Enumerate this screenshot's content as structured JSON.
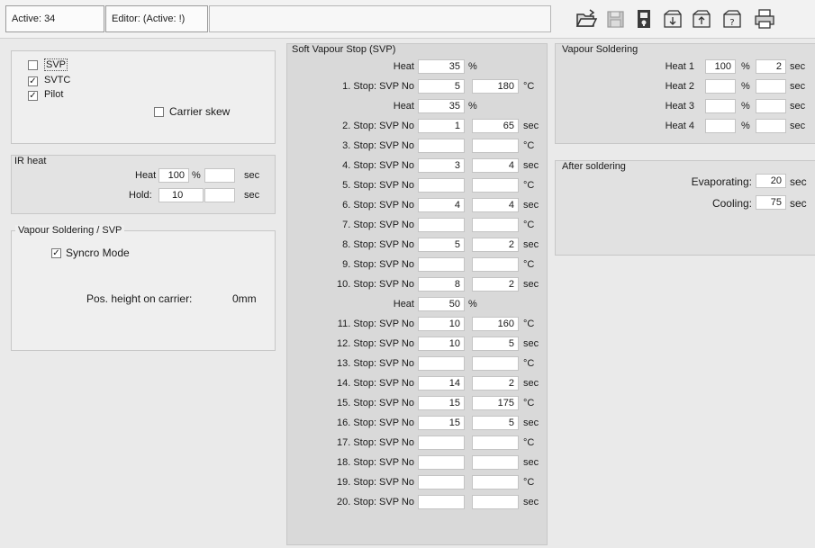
{
  "topbar": {
    "active": "Active: 34",
    "editor": "Editor:  (Active: !)",
    "icons": [
      "open-folder-icon",
      "save-disk-icon",
      "lock-icon",
      "tray-in-icon",
      "tray-out-icon",
      "tray-help-icon",
      "printer-icon"
    ]
  },
  "options": {
    "svp": {
      "label": "SVP",
      "checked": false
    },
    "svtc": {
      "label": "SVTC",
      "checked": true
    },
    "pilot": {
      "label": "Pilot",
      "checked": true
    },
    "carrier_skew": {
      "label": "Carrier skew",
      "checked": false
    }
  },
  "ir_heat": {
    "title": "IR heat",
    "heat_label": "Heat",
    "heat_value": "100",
    "heat_unit": "%",
    "heat_sec_unit": "sec",
    "hold_label": "Hold:",
    "hold_value": "10",
    "hold_unit": "sec"
  },
  "vs_svp": {
    "title": "Vapour Soldering / SVP",
    "syncro_label": "Syncro Mode",
    "syncro_checked": true,
    "pos_label": "Pos. height on carrier:",
    "pos_value": "0mm"
  },
  "svp": {
    "title": "Soft Vapour Stop (SVP)",
    "heat_label": "Heat",
    "pct": "%",
    "rows": [
      {
        "kind": "heat",
        "value": "35"
      },
      {
        "kind": "stop",
        "name": "1. Stop: SVP No",
        "no": "5",
        "val": "180",
        "unit": "°C"
      },
      {
        "kind": "heat",
        "value": "35"
      },
      {
        "kind": "stop",
        "name": "2. Stop: SVP No",
        "no": "1",
        "val": "65",
        "unit": "sec"
      },
      {
        "kind": "stop",
        "name": "3. Stop: SVP No",
        "no": "",
        "val": "",
        "unit": "°C"
      },
      {
        "kind": "stop",
        "name": "4. Stop: SVP No",
        "no": "3",
        "val": "4",
        "unit": "sec"
      },
      {
        "kind": "stop",
        "name": "5. Stop: SVP No",
        "no": "",
        "val": "",
        "unit": "°C"
      },
      {
        "kind": "stop",
        "name": "6. Stop: SVP No",
        "no": "4",
        "val": "4",
        "unit": "sec"
      },
      {
        "kind": "stop",
        "name": "7. Stop: SVP No",
        "no": "",
        "val": "",
        "unit": "°C"
      },
      {
        "kind": "stop",
        "name": "8. Stop: SVP No",
        "no": "5",
        "val": "2",
        "unit": "sec"
      },
      {
        "kind": "stop",
        "name": "9. Stop: SVP No",
        "no": "",
        "val": "",
        "unit": "°C"
      },
      {
        "kind": "stop",
        "name": "10. Stop: SVP No",
        "no": "8",
        "val": "2",
        "unit": "sec"
      },
      {
        "kind": "heat",
        "value": "50"
      },
      {
        "kind": "stop",
        "name": "11. Stop: SVP No",
        "no": "10",
        "val": "160",
        "unit": "°C"
      },
      {
        "kind": "stop",
        "name": "12. Stop: SVP No",
        "no": "10",
        "val": "5",
        "unit": "sec"
      },
      {
        "kind": "stop",
        "name": "13. Stop: SVP No",
        "no": "",
        "val": "",
        "unit": "°C"
      },
      {
        "kind": "stop",
        "name": "14. Stop: SVP No",
        "no": "14",
        "val": "2",
        "unit": "sec"
      },
      {
        "kind": "stop",
        "name": "15. Stop: SVP No",
        "no": "15",
        "val": "175",
        "unit": "°C"
      },
      {
        "kind": "stop",
        "name": "16. Stop: SVP No",
        "no": "15",
        "val": "5",
        "unit": "sec"
      },
      {
        "kind": "stop",
        "name": "17. Stop: SVP No",
        "no": "",
        "val": "",
        "unit": "°C"
      },
      {
        "kind": "stop",
        "name": "18. Stop: SVP No",
        "no": "",
        "val": "",
        "unit": "sec"
      },
      {
        "kind": "stop",
        "name": "19. Stop: SVP No",
        "no": "",
        "val": "",
        "unit": "°C"
      },
      {
        "kind": "stop",
        "name": "20. Stop: SVP No",
        "no": "",
        "val": "",
        "unit": "sec"
      }
    ]
  },
  "vapour_soldering": {
    "title": "Vapour Soldering",
    "rows": [
      {
        "label": "Heat 1",
        "pct": "100",
        "pct_unit": "%",
        "sec": "2",
        "sec_unit": "sec"
      },
      {
        "label": "Heat 2",
        "pct": "",
        "pct_unit": "%",
        "sec": "",
        "sec_unit": "sec"
      },
      {
        "label": "Heat 3",
        "pct": "",
        "pct_unit": "%",
        "sec": "",
        "sec_unit": "sec"
      },
      {
        "label": "Heat 4",
        "pct": "",
        "pct_unit": "%",
        "sec": "",
        "sec_unit": "sec"
      }
    ]
  },
  "after_soldering": {
    "title": "After soldering",
    "evaporating_label": "Evaporating:",
    "evaporating_value": "20",
    "evaporating_unit": "sec",
    "cooling_label": "Cooling:",
    "cooling_value": "75",
    "cooling_unit": "sec"
  }
}
